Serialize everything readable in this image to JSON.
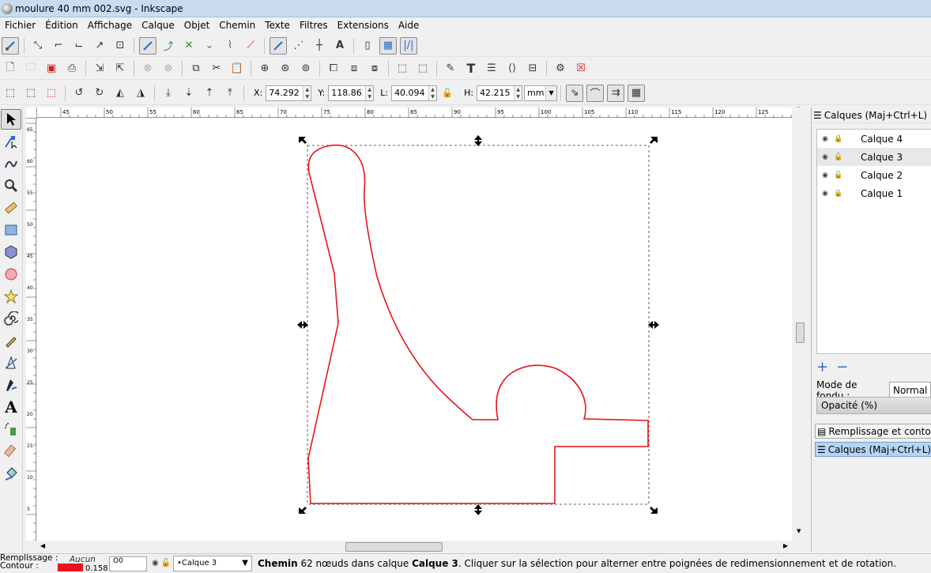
{
  "window": {
    "title": "moulure 40 mm 002.svg - Inkscape"
  },
  "menu": [
    "Fichier",
    "Édition",
    "Affichage",
    "Calque",
    "Objet",
    "Chemin",
    "Texte",
    "Filtres",
    "Extensions",
    "Aide"
  ],
  "transform": {
    "x_label": "X:",
    "x_value": "74.292",
    "y_label": "Y:",
    "y_value": "118.862",
    "w_label": "L:",
    "w_value": "40.094",
    "h_label": "H:",
    "h_value": "42.215",
    "unit": "mm"
  },
  "rulers": {
    "h_labels": [
      "45",
      "50",
      "55",
      "60",
      "65",
      "70",
      "75",
      "80",
      "85",
      "90",
      "95",
      "100",
      "105",
      "110",
      "115",
      "120",
      "125"
    ],
    "v_labels": [
      "65",
      "60",
      "55",
      "50",
      "45",
      "40",
      "35",
      "30",
      "25",
      "20",
      "15",
      "10",
      "5",
      "0"
    ]
  },
  "panel": {
    "title": "Calques (Maj+Ctrl+L)",
    "layers": [
      {
        "name": "Calque 4",
        "locked": true
      },
      {
        "name": "Calque 3",
        "locked": false
      },
      {
        "name": "Calque 2",
        "locked": false
      },
      {
        "name": "Calque 1",
        "locked": true
      }
    ],
    "selected_layer": "Calque 3",
    "blend_label": "Mode de fondu :",
    "blend_value": "Normal",
    "opacity_label": "Opacité (%)",
    "dock_tab_fill": "Remplissage et contour (",
    "dock_tab_layers": "Calques (Maj+Ctrl+L)"
  },
  "status": {
    "fill_label": "Remplissage :",
    "stroke_label": "Contour :",
    "fill_value": "Aucun",
    "stroke_width": "0.158",
    "opacity_value": "0",
    "current_layer": "•Calque 3",
    "message_bold1": "Chemin",
    "message_mid": " 62 nœuds dans calque ",
    "message_bold2": "Calque 3",
    "message_rest": ". Cliquer sur la sélection pour alterner entre poignées de redimensionnement et de rotation."
  },
  "colors": {
    "path_stroke": "#e8141b",
    "fill_swatch": "#e8141b"
  }
}
